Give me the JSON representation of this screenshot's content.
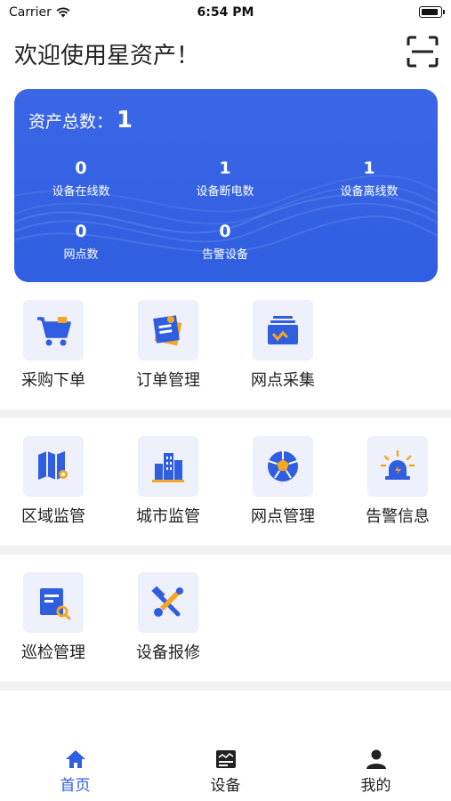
{
  "status": {
    "carrier": "Carrier",
    "time": "6:54 PM"
  },
  "header": {
    "title": "欢迎使用星资产！",
    "scan_icon": "scan-icon"
  },
  "summary": {
    "total_label": "资产总数：",
    "total_value": "1",
    "stats": [
      {
        "value": "0",
        "label": "设备在线数"
      },
      {
        "value": "1",
        "label": "设备断电数"
      },
      {
        "value": "1",
        "label": "设备离线数"
      },
      {
        "value": "0",
        "label": "网点数"
      },
      {
        "value": "0",
        "label": "告警设备"
      }
    ]
  },
  "menu": {
    "group1": [
      {
        "label": "采购下单",
        "icon": "cart-icon"
      },
      {
        "label": "订单管理",
        "icon": "order-icon"
      },
      {
        "label": "网点采集",
        "icon": "collect-icon"
      }
    ],
    "group2": [
      {
        "label": "区域监管",
        "icon": "map-icon"
      },
      {
        "label": "城市监管",
        "icon": "city-icon"
      },
      {
        "label": "网点管理",
        "icon": "network-icon"
      },
      {
        "label": "告警信息",
        "icon": "alarm-icon"
      }
    ],
    "group3": [
      {
        "label": "巡检管理",
        "icon": "inspection-icon"
      },
      {
        "label": "设备报修",
        "icon": "repair-icon"
      }
    ]
  },
  "tabbar": [
    {
      "label": "首页",
      "icon": "home-icon",
      "active": true
    },
    {
      "label": "设备",
      "icon": "device-icon",
      "active": false
    },
    {
      "label": "我的",
      "icon": "user-icon",
      "active": false
    }
  ],
  "colors": {
    "primary": "#2f5ee0",
    "accent": "#f5a623",
    "tile_bg": "#eef0fb",
    "active_tab": "#2f5ee0",
    "inactive_tab": "#222222"
  }
}
